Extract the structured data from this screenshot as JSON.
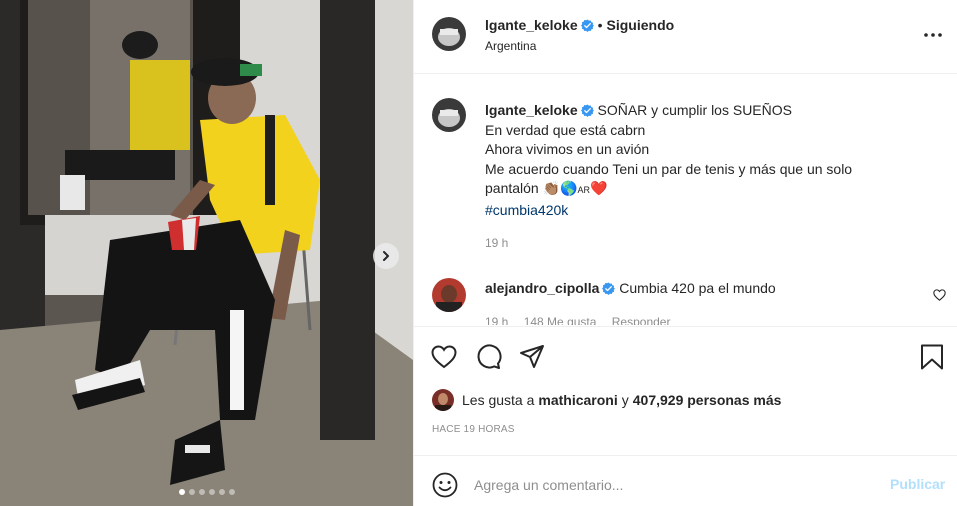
{
  "post": {
    "username": "lgante_keloke",
    "follow_label": "Siguiendo",
    "location": "Argentina",
    "photo_carousel": {
      "total": 6,
      "active_index": 1
    }
  },
  "caption": {
    "username": "lgante_keloke",
    "lines": [
      "SOÑAR y cumplir los SUEÑOS",
      "En verdad que está cabrn",
      "Ahora vivimos en un avión",
      "Me acuerdo cuando Teni un par de tenis y más que un solo",
      "pantalón 👏🏽🌎",
      "AR",
      "❤️"
    ],
    "hashtag": "#cumbia420k",
    "time": "19 h"
  },
  "comments": [
    {
      "username": "alejandro_cipolla",
      "text": "Cumbia 420 pa el mundo",
      "time": "19 h",
      "likes": "148 Me gusta",
      "reply": "Responder"
    }
  ],
  "likes": {
    "prefix": "Les gusta a",
    "user": "mathicaroni",
    "connector": "y",
    "others": "407,929 personas más"
  },
  "timestamp": "HACE 19 HORAS",
  "add_comment": {
    "placeholder": "Agrega un comentario...",
    "publish_label": "Publicar"
  },
  "icons": {
    "verified_color": "#3897f0",
    "link_color": "#00376b",
    "publish_color": "#b2dffc"
  }
}
